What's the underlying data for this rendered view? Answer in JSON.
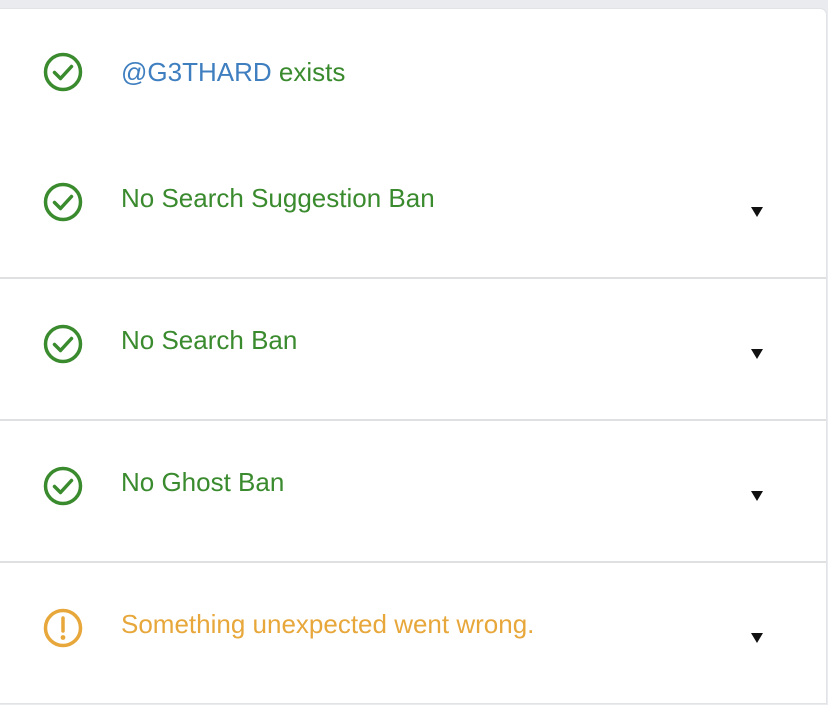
{
  "colors": {
    "success": "#3a8a2e",
    "warning": "#e7a73a",
    "link": "#3f7fc0"
  },
  "results": {
    "exists": {
      "handle": "@G3THARD",
      "suffix": " exists",
      "icon": "check-circle-icon"
    },
    "checks": [
      {
        "label": "No Search Suggestion Ban",
        "status": "ok",
        "icon": "check-circle-icon"
      },
      {
        "label": "No Search Ban",
        "status": "ok",
        "icon": "check-circle-icon"
      },
      {
        "label": "No Ghost Ban",
        "status": "ok",
        "icon": "check-circle-icon"
      },
      {
        "label": "Something unexpected went wrong.",
        "status": "warning",
        "icon": "exclamation-circle-icon"
      }
    ]
  }
}
